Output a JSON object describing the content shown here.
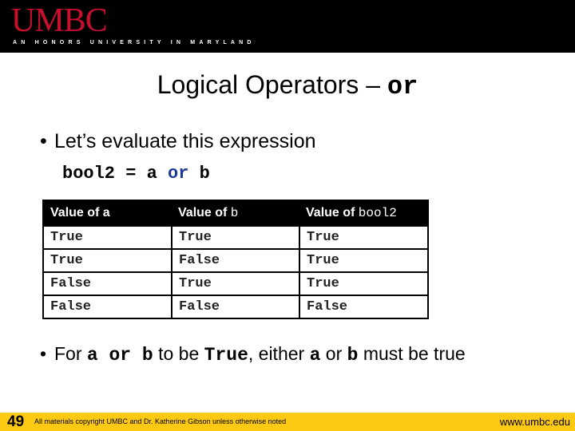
{
  "header": {
    "logo": "UMBC",
    "tagline": "AN HONORS UNIVERSITY IN MARYLAND"
  },
  "slide": {
    "title_text": "Logical Operators – ",
    "title_code": "or",
    "bullet1": "Let’s evaluate this expression",
    "expression": {
      "lhs": "bool2 = a ",
      "keyword": "or",
      "rhs": " b"
    },
    "table": {
      "headers": [
        {
          "label": "Value of a",
          "code": ""
        },
        {
          "label": "Value of ",
          "code": "b"
        },
        {
          "label": "Value of ",
          "code": "bool2"
        }
      ],
      "rows": [
        [
          "True",
          "True",
          "True"
        ],
        [
          "True",
          "False",
          "True"
        ],
        [
          "False",
          "True",
          "True"
        ],
        [
          "False",
          "False",
          "False"
        ]
      ]
    },
    "bullet2": {
      "p1": "For ",
      "c1": "a or b",
      "p2": " to be ",
      "c2": "True",
      "p3": ", either ",
      "c3": "a",
      "p4": " or ",
      "c4": "b",
      "p5": " must be true"
    }
  },
  "footer": {
    "page_number": "49",
    "copyright": "All materials copyright UMBC and Dr. Katherine Gibson unless otherwise noted",
    "url": "www.umbc.edu"
  },
  "colors": {
    "header_bg": "#000000",
    "logo_red": "#c8102e",
    "footer_gold": "#fdc912",
    "keyword_blue": "#1f3a93"
  }
}
